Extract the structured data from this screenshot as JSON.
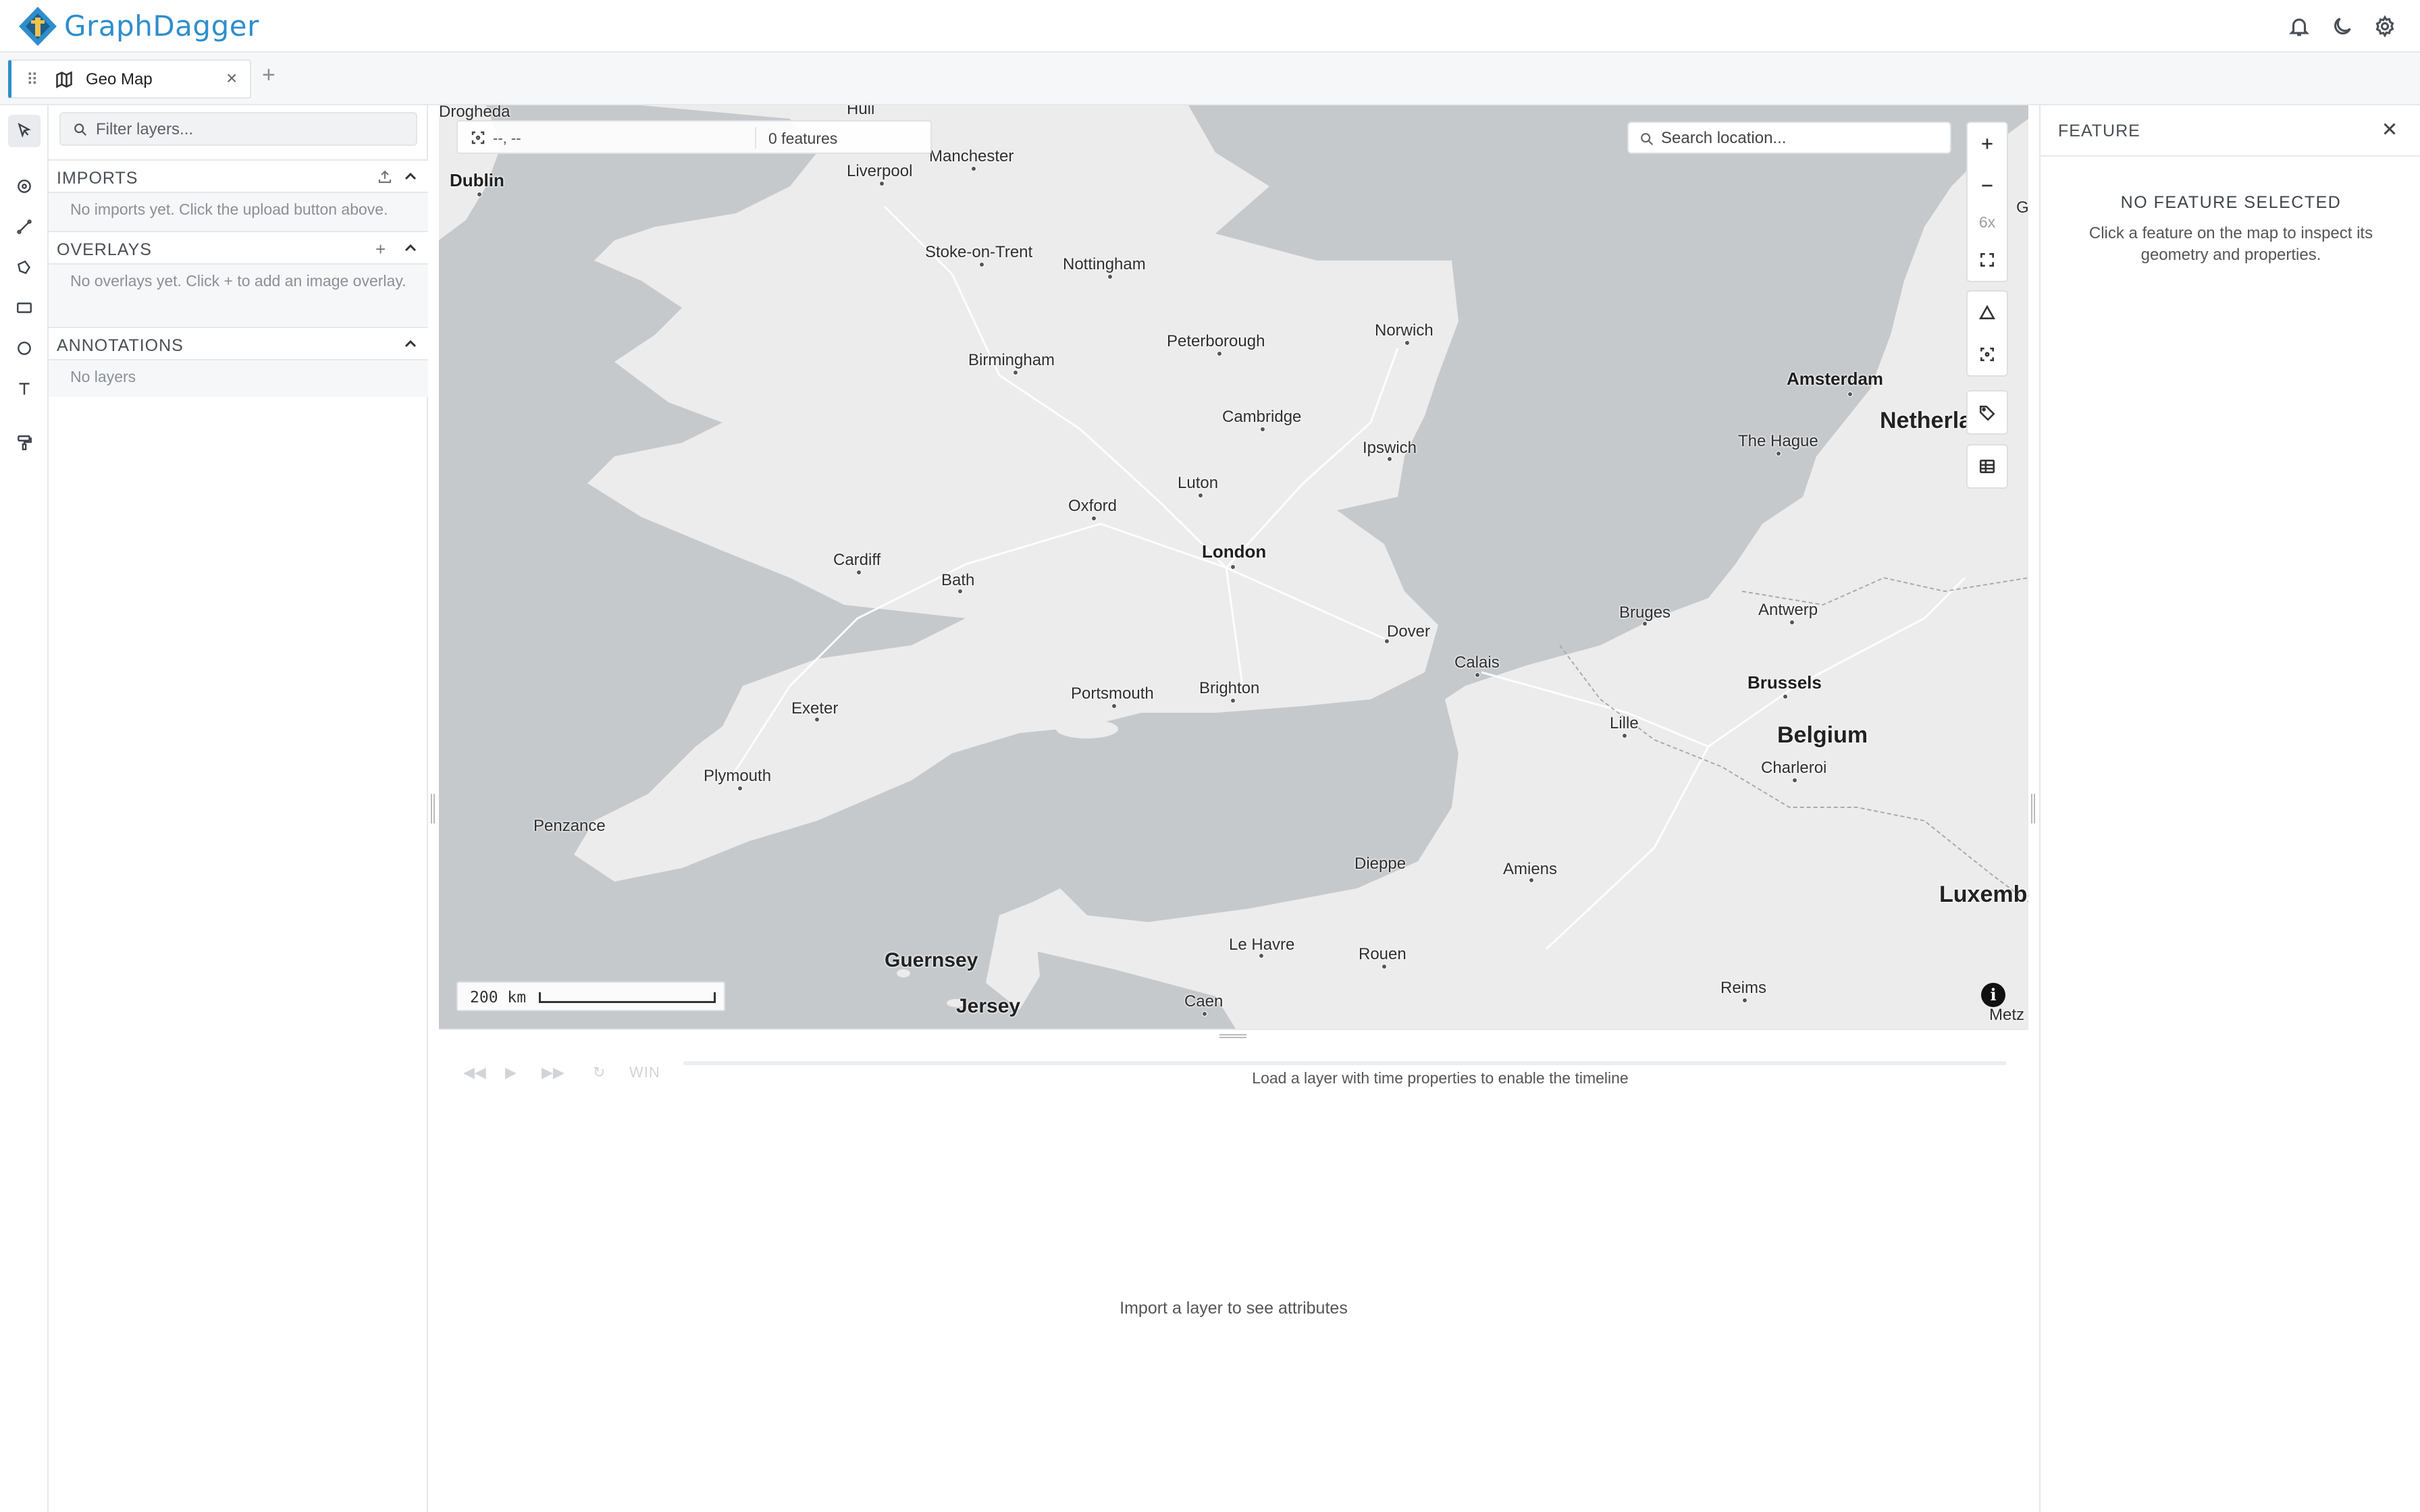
{
  "app": {
    "brand": "GraphDagger"
  },
  "colors": {
    "brand": "#2e8ecd",
    "map_water": "#c6c9cc",
    "map_land": "#efefef"
  },
  "header_icons": [
    "bell-icon",
    "moon-icon",
    "gear-icon"
  ],
  "tabs": [
    {
      "label": "Geo Map",
      "icon": "map-icon",
      "close": "×"
    }
  ],
  "tab_add": "+",
  "tools": [
    "select-arrow-icon",
    "point-icon",
    "line-icon",
    "polygon-icon",
    "rectangle-icon",
    "circle-icon",
    "text-icon",
    "style-paint-icon"
  ],
  "layers": {
    "filter_placeholder": "Filter layers...",
    "sections": {
      "imports": {
        "title": "IMPORTS",
        "empty": "No imports yet. Click the upload button above."
      },
      "overlays": {
        "title": "OVERLAYS",
        "action": "+",
        "empty": "No overlays yet. Click + to add an image overlay."
      },
      "annotations": {
        "title": "ANNOTATIONS",
        "empty": "No layers"
      }
    }
  },
  "map": {
    "coords": "--, --",
    "feature_count": "0 features",
    "search_placeholder": "Search location...",
    "zoom_level": "6x",
    "scale_label": "200 km",
    "info": "i",
    "labels": {
      "drogheda": "Drogheda",
      "dublin": "Dublin",
      "liverpool": "Liverpool",
      "manchester": "Manchester",
      "hull": "Hull",
      "stoke": "Stoke-on-Trent",
      "nottingham": "Nottingham",
      "birmingham": "Birmingham",
      "peterborough": "Peterborough",
      "norwich": "Norwich",
      "cambridge": "Cambridge",
      "ipswich": "Ipswich",
      "luton": "Luton",
      "oxford": "Oxford",
      "london": "London",
      "cardiff": "Cardiff",
      "bath": "Bath",
      "dover": "Dover",
      "calais": "Calais",
      "portsmouth": "Portsmouth",
      "brighton": "Brighton",
      "exeter": "Exeter",
      "plymouth": "Plymouth",
      "penzance": "Penzance",
      "dieppe": "Dieppe",
      "amiens": "Amiens",
      "le_havre": "Le Havre",
      "rouen": "Rouen",
      "caen": "Caen",
      "guernsey": "Guernsey",
      "jersey": "Jersey",
      "amsterdam": "Amsterdam",
      "the_hague": "The Hague",
      "netherlands": "Netherla",
      "bruges": "Bruges",
      "antwerp": "Antwerp",
      "brussels": "Brussels",
      "lille": "Lille",
      "belgium": "Belgium",
      "charleroi": "Charleroi",
      "luxembourg": "Luxembo",
      "reims": "Reims",
      "metz": "Metz",
      "g_edge": "G"
    }
  },
  "timeline": {
    "window_label": "WIN",
    "message": "Load a layer with time properties to enable the timeline"
  },
  "attributes": {
    "message": "Import a layer to see attributes"
  },
  "feature_panel": {
    "title": "FEATURE",
    "empty_title": "NO FEATURE SELECTED",
    "empty_desc": "Click a feature on the map to inspect its geometry and properties."
  }
}
